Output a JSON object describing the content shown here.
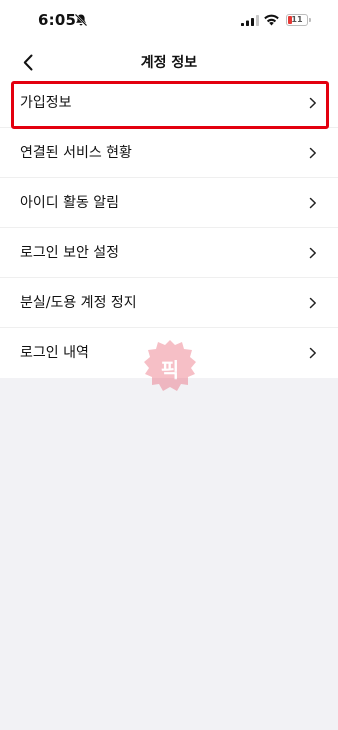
{
  "status_bar": {
    "time": "6:05",
    "battery_level": "11",
    "icons": [
      "bell-off-icon",
      "signal-icon",
      "wifi-icon",
      "battery-icon"
    ]
  },
  "header": {
    "title": "계정 정보",
    "back_icon": "chevron-left-icon"
  },
  "menu": {
    "items": [
      {
        "label": "가입정보",
        "icon": "chevron-right-icon",
        "highlighted": true
      },
      {
        "label": "연결된 서비스 현황",
        "icon": "chevron-right-icon"
      },
      {
        "label": "아이디 활동 알림",
        "icon": "chevron-right-icon"
      },
      {
        "label": "로그인 보안 설정",
        "icon": "chevron-right-icon"
      },
      {
        "label": "분실/도용 계정 정지",
        "icon": "chevron-right-icon"
      },
      {
        "label": "로그인 내역",
        "icon": "chevron-right-icon"
      }
    ]
  },
  "watermark": {
    "text": "픽",
    "color": "#e84a5f"
  },
  "colors": {
    "highlight": "#e3000f",
    "background": "#f2f2f5",
    "surface": "#ffffff",
    "battery_low": "#e53935"
  }
}
